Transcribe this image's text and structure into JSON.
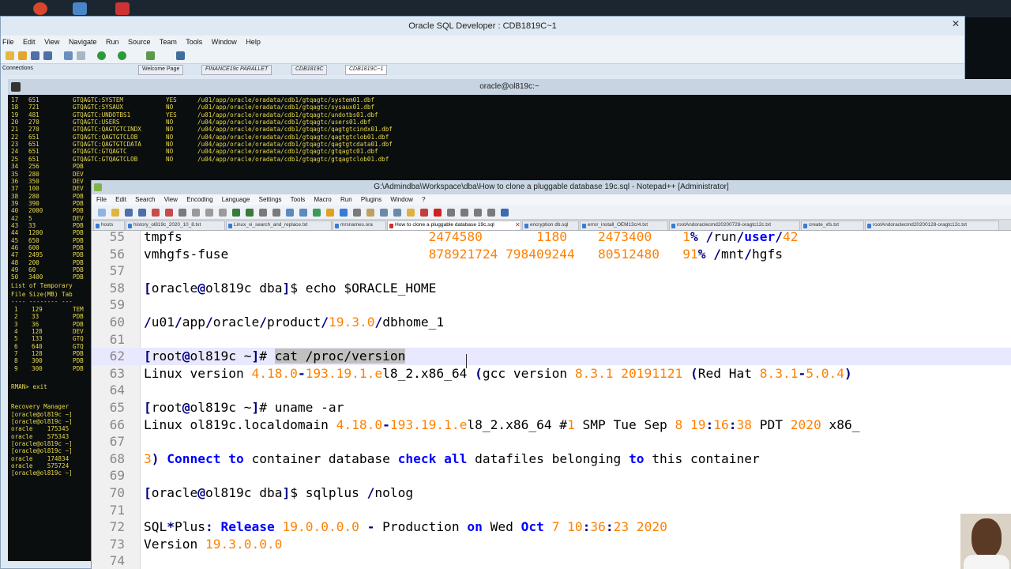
{
  "sqldev": {
    "title": "Oracle SQL Developer : CDB1819C~1",
    "menu": [
      "File",
      "Edit",
      "View",
      "Navigate",
      "Run",
      "Source",
      "Team",
      "Tools",
      "Window",
      "Help"
    ],
    "connections_label": "Connections",
    "tabs": [
      "Welcome Page",
      "FINANCE19c PARALLET",
      "CDB1819C",
      "CDB1819C~1"
    ]
  },
  "terminal": {
    "title": "oracle@ol819c:~",
    "rows": [
      {
        "a": "17",
        "b": "651",
        "c": "GTQAGTC:SYSTEM",
        "d": "YES",
        "e": "/u01/app/oracle/oradata/cdb1/gtqagtc/system01.dbf"
      },
      {
        "a": "18",
        "b": "721",
        "c": "GTQAGTC:SYSAUX",
        "d": "NO",
        "e": "/u01/app/oracle/oradata/cdb1/gtqagtc/sysaux01.dbf"
      },
      {
        "a": "19",
        "b": "481",
        "c": "GTQAGTC:UNDOTBS1",
        "d": "YES",
        "e": "/u01/app/oracle/oradata/cdb1/gtqagtc/undotbs01.dbf"
      },
      {
        "a": "20",
        "b": "270",
        "c": "GTQAGTC:USERS",
        "d": "NO",
        "e": "/u04/app/oracle/oradata/cdb1/gtqagtc/users01.dbf"
      },
      {
        "a": "21",
        "b": "270",
        "c": "GTQAGTC:QAGTGTCINDX",
        "d": "NO",
        "e": "/u04/app/oracle/oradata/cdb1/gtqagtc/qagtgtcindx01.dbf"
      },
      {
        "a": "22",
        "b": "651",
        "c": "GTQAGTC:QAGTGTCLOB",
        "d": "NO",
        "e": "/u04/app/oracle/oradata/cdb1/gtqagtc/qagtgtclob01.dbf"
      },
      {
        "a": "23",
        "b": "651",
        "c": "GTQAGTC:QAGTGTCDATA",
        "d": "NO",
        "e": "/u04/app/oracle/oradata/cdb1/gtqagtc/qagtgtcdata01.dbf"
      },
      {
        "a": "24",
        "b": "651",
        "c": "GTQAGTC:GTQAGTC",
        "d": "NO",
        "e": "/u04/app/oracle/oradata/cdb1/gtqagtc/gtqagtc01.dbf"
      },
      {
        "a": "25",
        "b": "651",
        "c": "GTQAGTC:GTQAGTCLOB",
        "d": "NO",
        "e": "/u04/app/oracle/oradata/cdb1/gtqagtc/gtqagtclob01.dbf"
      },
      {
        "a": "34",
        "b": "256",
        "c": "PDB",
        "d": "",
        "e": ""
      },
      {
        "a": "35",
        "b": "280",
        "c": "DEV",
        "d": "",
        "e": ""
      },
      {
        "a": "36",
        "b": "350",
        "c": "DEV",
        "d": "",
        "e": ""
      },
      {
        "a": "37",
        "b": "100",
        "c": "DEV",
        "d": "",
        "e": ""
      },
      {
        "a": "38",
        "b": "280",
        "c": "PDB",
        "d": "",
        "e": ""
      },
      {
        "a": "39",
        "b": "390",
        "c": "PDB",
        "d": "",
        "e": ""
      },
      {
        "a": "40",
        "b": "2000",
        "c": "PDB",
        "d": "",
        "e": ""
      },
      {
        "a": "42",
        "b": "5",
        "c": "DEV",
        "d": "",
        "e": ""
      },
      {
        "a": "43",
        "b": "33",
        "c": "PDB",
        "d": "",
        "e": ""
      },
      {
        "a": "44",
        "b": "1200",
        "c": "PDB",
        "d": "",
        "e": ""
      },
      {
        "a": "45",
        "b": "650",
        "c": "PDB",
        "d": "",
        "e": ""
      },
      {
        "a": "46",
        "b": "600",
        "c": "PDB",
        "d": "",
        "e": ""
      },
      {
        "a": "47",
        "b": "2495",
        "c": "PDB",
        "d": "",
        "e": ""
      },
      {
        "a": "48",
        "b": "200",
        "c": "PDB",
        "d": "",
        "e": ""
      },
      {
        "a": "49",
        "b": "60",
        "c": "PDB",
        "d": "",
        "e": ""
      },
      {
        "a": "50",
        "b": "3400",
        "c": "PDB",
        "d": "",
        "e": ""
      }
    ],
    "temp_title": "List of Temporary",
    "temp_header": "File Size(MB) Tab",
    "temp_rule": "---- -------- ---",
    "temp_rows": [
      {
        "a": "1",
        "b": "129",
        "c": "TEM"
      },
      {
        "a": "2",
        "b": "33",
        "c": "PDB"
      },
      {
        "a": "3",
        "b": "36",
        "c": "PDB"
      },
      {
        "a": "4",
        "b": "128",
        "c": "DEV"
      },
      {
        "a": "5",
        "b": "133",
        "c": "GTQ"
      },
      {
        "a": "6",
        "b": "640",
        "c": "GTQ"
      },
      {
        "a": "7",
        "b": "128",
        "c": "PDB"
      },
      {
        "a": "8",
        "b": "300",
        "c": "PDB"
      },
      {
        "a": "9",
        "b": "300",
        "c": "PDB"
      }
    ],
    "rman_exit": "RMAN> exit",
    "tail": [
      "Recovery Manager",
      "[oracle@ol819c ~]",
      "[oracle@ol819c ~]",
      "oracle    175345",
      "oracle    575343",
      "[oracle@ol819c ~]",
      "[oracle@ol819c ~]",
      "oracle    174834",
      "oracle    575724",
      "[oracle@ol819c ~]"
    ]
  },
  "npp": {
    "title": "G:\\Admindba\\Workspace\\dba\\How to clone a pluggable database 19c.sql - Notepad++ [Administrator]",
    "menu": [
      "File",
      "Edit",
      "Search",
      "View",
      "Encoding",
      "Language",
      "Settings",
      "Tools",
      "Macro",
      "Run",
      "Plugins",
      "Window",
      "?"
    ],
    "tabs": [
      "hosts",
      "history_ol819c_2020_10_8.txt",
      "Linux_vi_search_and_replace.txt",
      "mrsnames.ora",
      "How to clone a pluggable database 19c.sql",
      "encryption db.sql",
      "error_install_OEM13cr4.txt",
      "rootAndoraclecmd20200728-oragtc12c.txt",
      "create_xfs.txt",
      "rootAndoraclecmd20200128-oragtc12c.txt"
    ],
    "active_tab_index": 4
  },
  "editor": {
    "lines": [
      {
        "num": "55",
        "segs": [
          [
            "",
            "tmpfs                                "
          ],
          [
            "n",
            "2474580"
          ],
          [
            "",
            "       "
          ],
          [
            "n",
            "1180"
          ],
          [
            "",
            "    "
          ],
          [
            "n",
            "2473400"
          ],
          [
            "",
            "    "
          ],
          [
            "n",
            "1"
          ],
          [
            "o",
            "%"
          ],
          [
            "",
            " "
          ],
          [
            "o",
            "/"
          ],
          [
            "",
            "run"
          ],
          [
            "o",
            "/"
          ],
          [
            "k",
            "user"
          ],
          [
            "o",
            "/"
          ],
          [
            "n",
            "42"
          ]
        ]
      },
      {
        "num": "56",
        "segs": [
          [
            "",
            "vmhgfs-fuse                          "
          ],
          [
            "n",
            "878921724"
          ],
          [
            "",
            " "
          ],
          [
            "n",
            "798409244"
          ],
          [
            "",
            "   "
          ],
          [
            "n",
            "80512480"
          ],
          [
            "",
            "   "
          ],
          [
            "n",
            "91"
          ],
          [
            "o",
            "%"
          ],
          [
            "",
            " "
          ],
          [
            "o",
            "/"
          ],
          [
            "",
            "mnt"
          ],
          [
            "o",
            "/"
          ],
          [
            "",
            "hgfs"
          ]
        ]
      },
      {
        "num": "57",
        "segs": []
      },
      {
        "num": "58",
        "segs": [
          [
            "o",
            "["
          ],
          [
            "",
            "oracle"
          ],
          [
            "o",
            "@"
          ],
          [
            "",
            "ol819c dba"
          ],
          [
            "o",
            "]"
          ],
          [
            "",
            "$ echo $ORACLE_HOME"
          ]
        ]
      },
      {
        "num": "59",
        "segs": []
      },
      {
        "num": "60",
        "segs": [
          [
            "o",
            "/"
          ],
          [
            "",
            "u01"
          ],
          [
            "o",
            "/"
          ],
          [
            "",
            "app"
          ],
          [
            "o",
            "/"
          ],
          [
            "",
            "oracle"
          ],
          [
            "o",
            "/"
          ],
          [
            "",
            "product"
          ],
          [
            "o",
            "/"
          ],
          [
            "n",
            "19.3.0"
          ],
          [
            "o",
            "/"
          ],
          [
            "",
            "dbhome_1"
          ]
        ]
      },
      {
        "num": "61",
        "segs": []
      },
      {
        "num": "62",
        "segs": [
          [
            "o",
            "["
          ],
          [
            "",
            "root"
          ],
          [
            "o",
            "@"
          ],
          [
            "",
            "ol819c ~"
          ],
          [
            "o",
            "]"
          ],
          [
            "",
            "# "
          ],
          [
            "sel",
            "cat /proc/version"
          ]
        ]
      },
      {
        "num": "63",
        "segs": [
          [
            "",
            "Linux version "
          ],
          [
            "n",
            "4.18.0"
          ],
          [
            "o",
            "-"
          ],
          [
            "n",
            "193.19.1.e"
          ],
          [
            "",
            "l8_2.x86_64 "
          ],
          [
            "o",
            "("
          ],
          [
            "",
            "gcc version "
          ],
          [
            "n",
            "8.3.1 20191121"
          ],
          [
            "",
            " "
          ],
          [
            "o",
            "("
          ],
          [
            "",
            "Red Hat "
          ],
          [
            "n",
            "8.3.1"
          ],
          [
            "o",
            "-"
          ],
          [
            "n",
            "5.0.4"
          ],
          [
            "o",
            ")"
          ]
        ]
      },
      {
        "num": "64",
        "segs": []
      },
      {
        "num": "65",
        "segs": [
          [
            "o",
            "["
          ],
          [
            "",
            "root"
          ],
          [
            "o",
            "@"
          ],
          [
            "",
            "ol819c ~"
          ],
          [
            "o",
            "]"
          ],
          [
            "",
            "# uname -ar"
          ]
        ]
      },
      {
        "num": "66",
        "segs": [
          [
            "",
            "Linux ol819c.localdomain "
          ],
          [
            "n",
            "4.18.0"
          ],
          [
            "o",
            "-"
          ],
          [
            "n",
            "193.19.1.e"
          ],
          [
            "",
            "l8_2.x86_64 #"
          ],
          [
            "n",
            "1"
          ],
          [
            "",
            " SMP Tue Sep "
          ],
          [
            "n",
            "8 19"
          ],
          [
            "o",
            ":"
          ],
          [
            "n",
            "16"
          ],
          [
            "o",
            ":"
          ],
          [
            "n",
            "38"
          ],
          [
            "",
            " PDT "
          ],
          [
            "n",
            "2020"
          ],
          [
            "",
            " x86_"
          ]
        ]
      },
      {
        "num": "67",
        "segs": []
      },
      {
        "num": "68",
        "segs": [
          [
            "n",
            "3"
          ],
          [
            "o",
            ")"
          ],
          [
            "",
            " "
          ],
          [
            "k",
            "Connect"
          ],
          [
            "",
            " "
          ],
          [
            "k",
            "to"
          ],
          [
            "",
            " container database "
          ],
          [
            "k",
            "check"
          ],
          [
            "",
            " "
          ],
          [
            "k",
            "all"
          ],
          [
            "",
            " datafiles belonging "
          ],
          [
            "k",
            "to"
          ],
          [
            "",
            " this container"
          ]
        ]
      },
      {
        "num": "69",
        "segs": []
      },
      {
        "num": "70",
        "segs": [
          [
            "o",
            "["
          ],
          [
            "",
            "oracle"
          ],
          [
            "o",
            "@"
          ],
          [
            "",
            "ol819c dba"
          ],
          [
            "o",
            "]"
          ],
          [
            "",
            "$ sqlplus "
          ],
          [
            "o",
            "/"
          ],
          [
            "",
            "nolog"
          ]
        ]
      },
      {
        "num": "71",
        "segs": []
      },
      {
        "num": "72",
        "segs": [
          [
            "",
            "SQL"
          ],
          [
            "o",
            "*"
          ],
          [
            "",
            "Plus"
          ],
          [
            "o",
            ":"
          ],
          [
            "",
            " "
          ],
          [
            "k",
            "Release"
          ],
          [
            "",
            " "
          ],
          [
            "n",
            "19.0.0.0.0"
          ],
          [
            "",
            " "
          ],
          [
            "o",
            "-"
          ],
          [
            "",
            " Production "
          ],
          [
            "k",
            "on"
          ],
          [
            "",
            " Wed "
          ],
          [
            "k",
            "Oct"
          ],
          [
            "",
            " "
          ],
          [
            "n",
            "7 10"
          ],
          [
            "o",
            ":"
          ],
          [
            "n",
            "36"
          ],
          [
            "o",
            ":"
          ],
          [
            "n",
            "23 2020"
          ]
        ]
      },
      {
        "num": "73",
        "segs": [
          [
            "",
            "Version "
          ],
          [
            "n",
            "19.3.0.0.0"
          ]
        ]
      },
      {
        "num": "74",
        "segs": []
      }
    ]
  },
  "colors": {
    "terminal_text": "#e8d94c",
    "npp_number": "#ff8000",
    "npp_keyword": "#0000ff",
    "npp_operator": "#000080"
  }
}
